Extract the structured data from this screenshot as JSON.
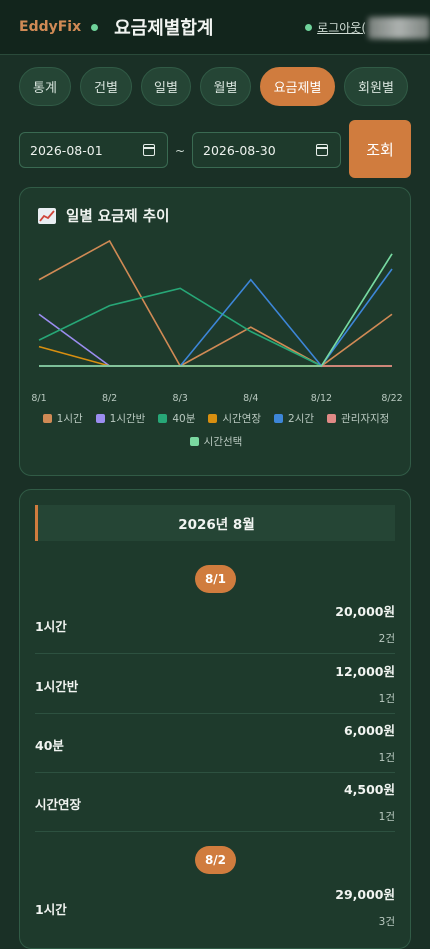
{
  "header": {
    "brand": "EddyFix",
    "title": "요금제별합계",
    "logout": "로그아웃("
  },
  "tabs": [
    {
      "label": "통계",
      "active": false
    },
    {
      "label": "건별",
      "active": false
    },
    {
      "label": "일별",
      "active": false
    },
    {
      "label": "월별",
      "active": false
    },
    {
      "label": "요금제별",
      "active": true
    },
    {
      "label": "회원별",
      "active": false
    }
  ],
  "filter": {
    "start_date": "2026-08-01",
    "separator": "~",
    "end_date": "2026-08-30",
    "search_label": "조회"
  },
  "chart_card": {
    "title": "일별 요금제 추이"
  },
  "chart_data": {
    "type": "line",
    "categories": [
      "8/1",
      "8/2",
      "8/3",
      "8/4",
      "8/12",
      "8/22"
    ],
    "ylim": [
      0,
      32000
    ],
    "grid": false,
    "legend_position": "bottom",
    "series": [
      {
        "name": "1시간",
        "color": "#d08a55",
        "values": [
          20000,
          29000,
          0,
          9000,
          0,
          12000
        ]
      },
      {
        "name": "1시간반",
        "color": "#9b8df0",
        "values": [
          12000,
          0,
          0,
          0,
          0,
          0
        ]
      },
      {
        "name": "40분",
        "color": "#27a777",
        "values": [
          6000,
          14000,
          18000,
          8000,
          0,
          26000
        ]
      },
      {
        "name": "시간연장",
        "color": "#d88f10",
        "values": [
          4500,
          0,
          0,
          0,
          0,
          0
        ]
      },
      {
        "name": "2시간",
        "color": "#3d86d8",
        "values": [
          0,
          0,
          0,
          20000,
          0,
          22500
        ]
      },
      {
        "name": "관리자지정",
        "color": "#e08a86",
        "values": [
          0,
          0,
          0,
          0,
          0,
          0
        ]
      },
      {
        "name": "시간선택",
        "color": "#7ad8a0",
        "values": [
          0,
          0,
          0,
          0,
          0,
          26000
        ]
      }
    ]
  },
  "list": {
    "month": "2026년 8월",
    "days": [
      {
        "label": "8/1",
        "rows": [
          {
            "name": "1시간",
            "amount": "20,000원",
            "count": "2건"
          },
          {
            "name": "1시간반",
            "amount": "12,000원",
            "count": "1건"
          },
          {
            "name": "40분",
            "amount": "6,000원",
            "count": "1건"
          },
          {
            "name": "시간연장",
            "amount": "4,500원",
            "count": "1건"
          }
        ]
      },
      {
        "label": "8/2",
        "rows": [
          {
            "name": "1시간",
            "amount": "29,000원",
            "count": "3건"
          }
        ]
      }
    ]
  }
}
